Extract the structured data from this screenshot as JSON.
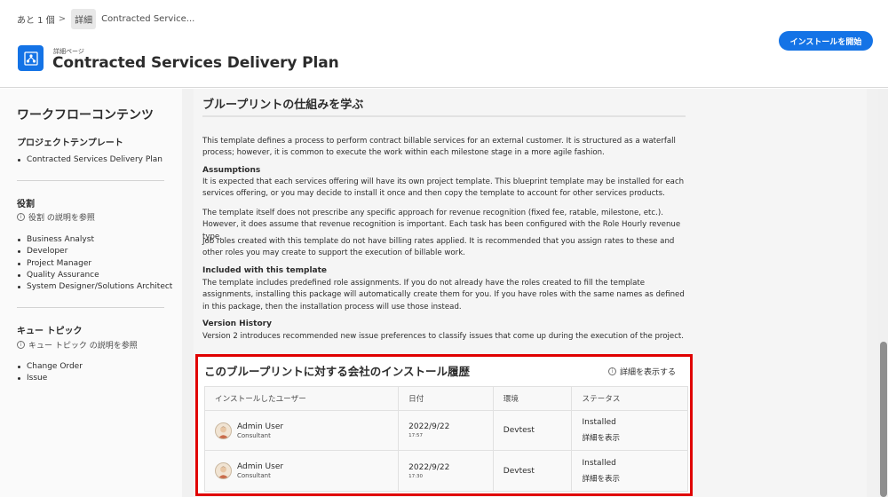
{
  "breadcrumb": {
    "root": "あと 1 個",
    "sep": ">",
    "current": "詳細",
    "tail": "Contracted Service..."
  },
  "header": {
    "kicker": "詳細ページ",
    "title": "Contracted Services Delivery Plan",
    "install_button": "インストールを開始"
  },
  "sidebar": {
    "title": "ワークフローコンテンツ",
    "project_section": "プロジェクトテンプレート",
    "project_items": [
      "Contracted Services Delivery Plan"
    ],
    "roles_section": "役割",
    "roles_info": "役割 の説明を参照",
    "roles_items": [
      "Business Analyst",
      "Developer",
      "Project Manager",
      "Quality Assurance",
      "System Designer/Solutions Architect"
    ],
    "queue_section": "キュー トピック",
    "queue_info": "キュー トピック の説明を参照",
    "queue_items": [
      "Change Order",
      "Issue"
    ]
  },
  "learn": {
    "title": "ブループリントの仕組みを学ぶ",
    "intro": "This template defines a process to perform contract billable services for an external customer. It is structured as a waterfall process; however, it is common to execute the work within each milestone stage in a more agile fashion.",
    "assumptions_h": "Assumptions",
    "assumptions_p1": "It is expected that each services offering will have its own project template. This blueprint template may be installed for each services offering, or you may decide to install it once and then copy the template to account for other services products.",
    "assumptions_p2": "The template itself does not prescribe any specific approach for revenue recognition (fixed fee, ratable, milestone, etc.). However, it does assume that revenue recognition is important. Each task has been configured with the Role Hourly revenue type.",
    "assumptions_p3": "Job roles created with this template do not have billing rates applied. It is recommended that you assign rates to these and other roles you may create to support the execution of billable work.",
    "included_h": "Included with this template",
    "included_p": "The template includes predefined role assignments. If you do not already have the roles created to fill the template assignments, installing this package will automatically create them for you. If you have roles with the same names as defined in this package, then the installation process will use those instead.",
    "version_h": "Version History",
    "version_p": "Version 2 introduces recommended new issue preferences to classify issues that come up during the execution of the project."
  },
  "history": {
    "title": "このブループリントに対する会社のインストール履歴",
    "details_link": "詳細を表示する",
    "columns": [
      "インストールしたユーザー",
      "日付",
      "環境",
      "ステータス"
    ],
    "rows": [
      {
        "user": "Admin User",
        "role": "Consultant",
        "date": "2022/9/22",
        "time": "17:57",
        "env": "Devtest",
        "status": "Installed",
        "status_link": "詳細を表示"
      },
      {
        "user": "Admin User",
        "role": "Consultant",
        "date": "2022/9/22",
        "time": "17:30",
        "env": "Devtest",
        "status": "Installed",
        "status_link": "詳細を表示"
      }
    ]
  },
  "colors": {
    "accent": "#1473e6",
    "highlight_border": "#e00000"
  },
  "icons": {
    "app": "blueprint-icon",
    "info": "info-icon",
    "avatar": "user-avatar-icon"
  }
}
